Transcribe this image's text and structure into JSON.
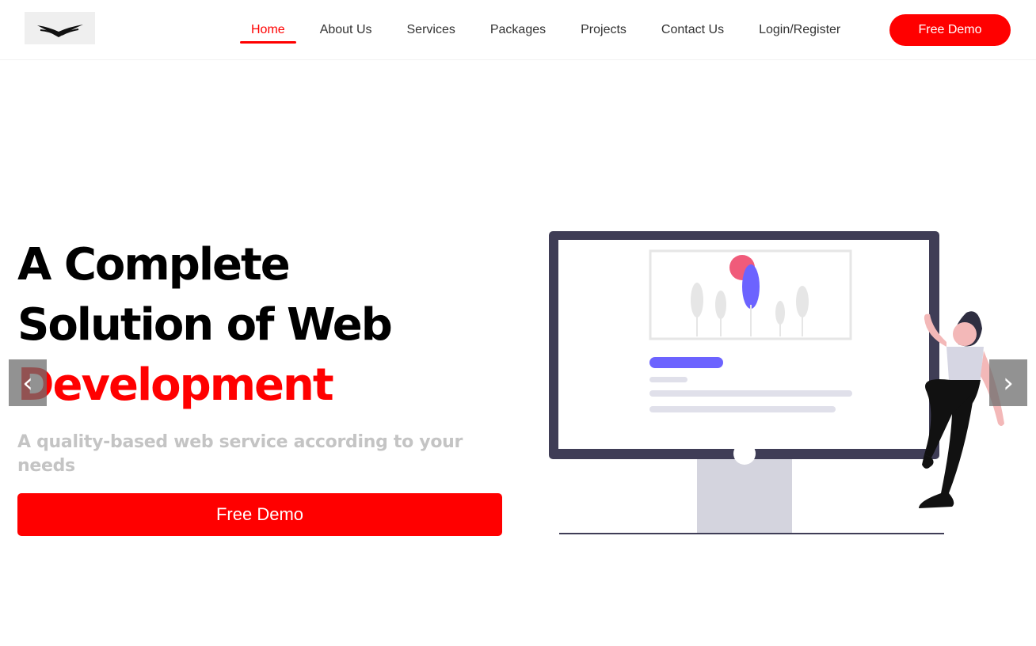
{
  "nav": {
    "items": [
      {
        "label": "Home",
        "active": true
      },
      {
        "label": "About Us",
        "active": false
      },
      {
        "label": "Services",
        "active": false
      },
      {
        "label": "Packages",
        "active": false
      },
      {
        "label": "Projects",
        "active": false
      },
      {
        "label": "Contact Us",
        "active": false
      },
      {
        "label": "Login/Register",
        "active": false
      }
    ],
    "cta_label": "Free Demo"
  },
  "hero": {
    "title_line1": "A Complete",
    "title_line2": "Solution of Web",
    "title_highlight": "Development",
    "subtitle": "A quality-based web service according to your needs",
    "cta_label": "Free Demo"
  },
  "carousel": {
    "prev_icon": "‹",
    "next_icon": "›"
  },
  "colors": {
    "accent": "#ff0000",
    "text": "#000000",
    "muted": "#c4c4c4",
    "illustration_purple": "#6c63ff",
    "illustration_pink": "#f05b7a",
    "monitor_frame": "#3f3d56"
  }
}
